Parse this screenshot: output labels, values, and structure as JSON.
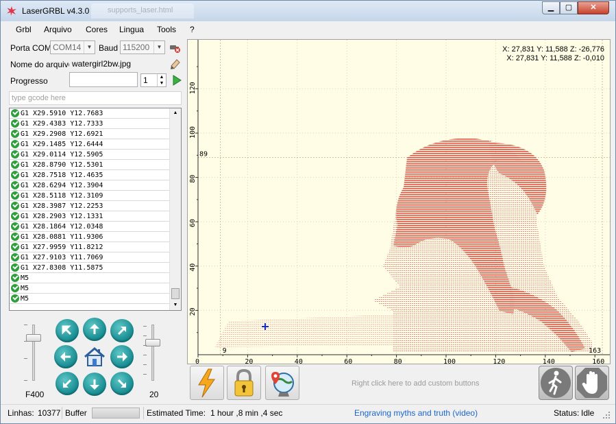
{
  "window": {
    "title": "LaserGRBL v4.3.0",
    "background_tab": "supports_laser.html"
  },
  "menu": [
    "Grbl",
    "Arquivo",
    "Cores",
    "Lingua",
    "Tools",
    "?"
  ],
  "connection": {
    "port_label": "Porta COM",
    "port_value": "COM14",
    "baud_label": "Baud",
    "baud_value": "115200"
  },
  "file": {
    "label": "Nome do arquivo",
    "value": "watergirl2bw.jpg"
  },
  "progress": {
    "label": "Progresso",
    "passes": "1"
  },
  "gcode_input": {
    "placeholder": "type gcode here"
  },
  "code_lines": [
    "G1 X29.5910 Y12.7683",
    "G1 X29.4383 Y12.7333",
    "G1 X29.2908 Y12.6921",
    "G1 X29.1485 Y12.6444",
    "G1 X29.0114 Y12.5905",
    "G1 X28.8790 Y12.5301",
    "G1 X28.7518 Y12.4635",
    "G1 X28.6294 Y12.3904",
    "G1 X28.5118 Y12.3109",
    "G1 X28.3987 Y12.2253",
    "G1 X28.2903 Y12.1331",
    "G1 X28.1864 Y12.0348",
    "G1 X28.0881 Y11.9306",
    "G1 X27.9959 Y11.8212",
    "G1 X27.9103 Y11.7069",
    "G1 X27.8308 Y11.5875",
    "M5",
    "M5",
    "M5"
  ],
  "jog": {
    "feed_label": "F400",
    "step_label": "20"
  },
  "canvas": {
    "coord_line1": "X: 27,831 Y: 11,588 Z: -26,776",
    "coord_line2": "X: 27,831 Y: 11,588 Z: -0,010",
    "x_ticks": [
      "0",
      "20",
      "40",
      "60",
      "80",
      "100",
      "120",
      "140",
      "160"
    ],
    "y_ticks": [
      "120",
      "100",
      "80",
      "60",
      "40",
      "20"
    ],
    "x_extent_labels": [
      "9",
      "163"
    ],
    "y_extent_label": "89",
    "engraving_color": "#e0574a"
  },
  "toolbar": {
    "custom_hint": "Right click here to add custom buttons"
  },
  "status": {
    "lines_label": "Linhas:",
    "lines_value": "10377",
    "buffer_label": "Buffer",
    "estimated_label": "Estimated Time:",
    "estimated_value": "1 hour ,8 min ,4 sec",
    "link": "Engraving myths and truth (video)",
    "status_label": "Status:",
    "status_value": "Idle"
  }
}
